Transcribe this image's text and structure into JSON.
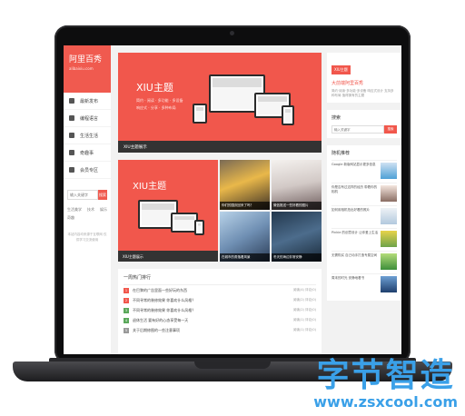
{
  "site": {
    "name": "阿里百秀",
    "domain": "alibaixiu.com"
  },
  "nav": {
    "items": [
      {
        "label": "最新发布",
        "icon": "list-icon"
      },
      {
        "label": "编程语言",
        "icon": "code-icon"
      },
      {
        "label": "生活生活",
        "icon": "home-icon"
      },
      {
        "label": "奇趣事",
        "icon": "star-icon"
      },
      {
        "label": "会员专区",
        "icon": "vip-icon"
      }
    ]
  },
  "sidebar_search": {
    "placeholder": "输入关键字",
    "button": "搜索"
  },
  "sidebar_tags": [
    "生活美学",
    "技术",
    "娱乐",
    "奇趣"
  ],
  "sidebar_footer": "本站内容均来源于互联网 仅供学习交流使用",
  "hero": {
    "title": "XIU主题",
    "lines": [
      "简约 · 阅读 · 多功能 · 多设备",
      "响应式 · 分享 · 多种布局"
    ],
    "caption": "XIU主题展示"
  },
  "hero2": {
    "title": "XIU主题",
    "caption": "XIU主题展示"
  },
  "tiles": [
    {
      "caption": "你们的国庆回来了吗？"
    },
    {
      "caption": "微信推送一些好看的图片"
    },
    {
      "caption": "在城市的角落看风景"
    },
    {
      "caption": "冬天的海边非常安静"
    }
  ],
  "hot": {
    "heading": "一周热门排行",
    "items": [
      {
        "title": "在巴黎的广告里面一些好玩的东西",
        "meta": "阅读(4)  评论(0)"
      },
      {
        "title": "不同寻常的装修效果 你喜欢什么风格？",
        "meta": "阅读(2)  评论(0)"
      },
      {
        "title": "不同寻常的装修效果 你喜欢什么风格？",
        "meta": "阅读(2)  评论(0)"
      },
      {
        "title": "退休生活 要有好的心态享受每一天",
        "meta": "阅读(1)  评论(0)"
      },
      {
        "title": "关于后期修图的一些注意事项",
        "meta": "阅读(1)  评论(0)"
      }
    ],
    "num_colors": [
      "#f1574c",
      "#f1574c",
      "#5aa85a",
      "#5aa85a",
      "#999999"
    ]
  },
  "right_promo": {
    "badge": "XIU主题",
    "title": "大前端阿里百秀",
    "desc": "简约·阅读·多功能·多设备 响应式设计 支持多种布局 值得拥有的主题"
  },
  "right_search": {
    "heading": "搜索",
    "placeholder": "输入关键字",
    "button": "搜索"
  },
  "right_list": {
    "heading": "随机推荐",
    "items": [
      "Google 新版网站显示更多信息",
      "你是否有过这样的经历 带着你的相机",
      "如何用相机拍出好看的照片",
      "Pinkie 的创意设计 让你爱上生活",
      "无需购买 自己动手打造专属空间",
      "周末的时光 安静地看书"
    ]
  },
  "watermark": {
    "brand": "字节智造",
    "url": "www.zsxcool.com"
  },
  "colors": {
    "accent": "#f1574c",
    "watermark": "#3aa0e8"
  }
}
